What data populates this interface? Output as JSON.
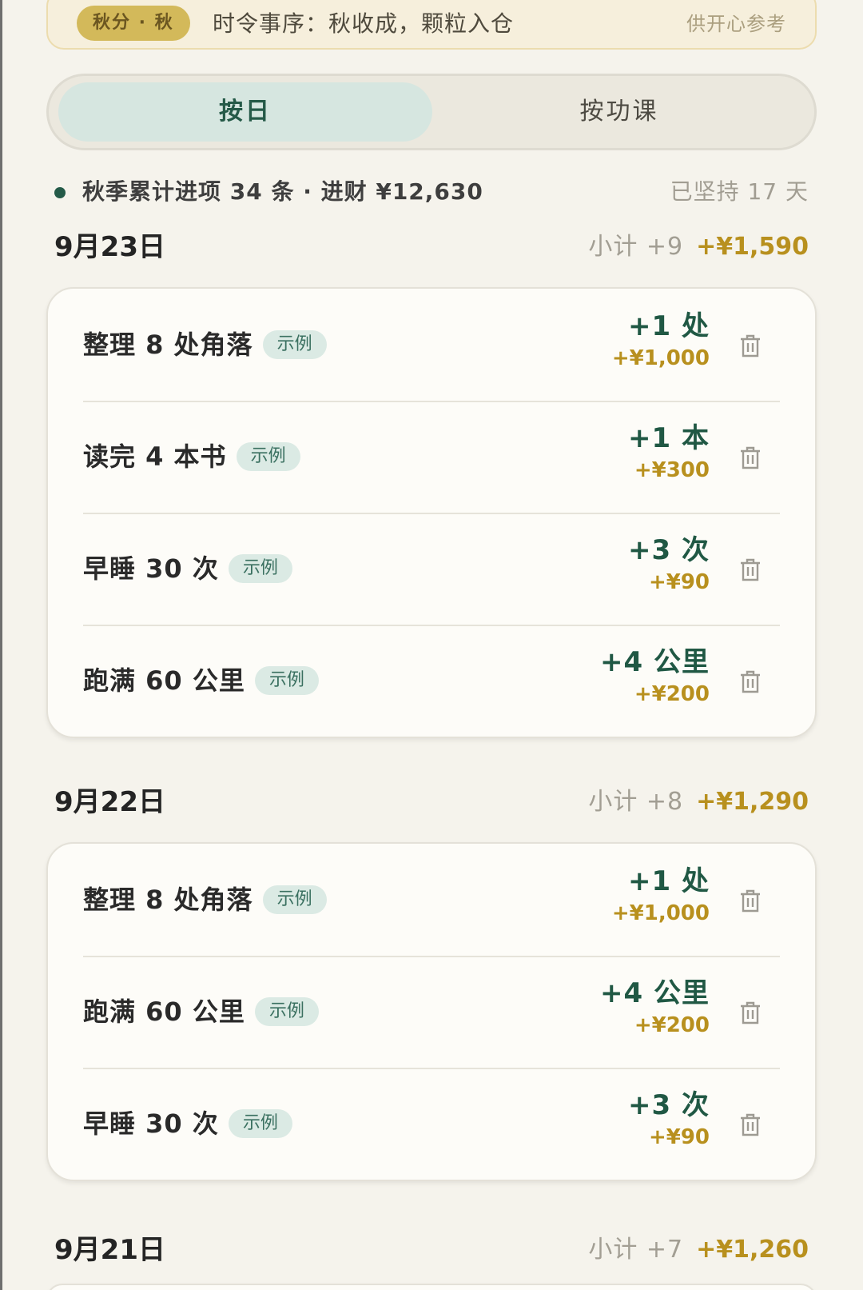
{
  "banner": {
    "badge": "秋分 · 秋",
    "text": "时令事序：秋收成，颗粒入仓",
    "note": "供开心参考"
  },
  "tabs": [
    {
      "label": "按日",
      "active": true
    },
    {
      "label": "按功课",
      "active": false
    }
  ],
  "summary": {
    "text": "秋季累计进项 34 条 · 进财 ¥12,630",
    "streak": "已坚持 17 天"
  },
  "colors": {
    "accent_green": "#245a48",
    "gold": "#b8901e",
    "tag_bg": "#dbeae4",
    "page_bg": "#f5f3ec"
  },
  "icons": {
    "delete": "trash-icon",
    "bullet": "dot-icon"
  },
  "days": [
    {
      "date": "9月23日",
      "count": "小计 +9",
      "money": "+¥1,590",
      "items": [
        {
          "title": "整理 8 处角落",
          "tag": "示例",
          "gain": "+1 处",
          "money": "+¥1,000"
        },
        {
          "title": "读完 4 本书",
          "tag": "示例",
          "gain": "+1 本",
          "money": "+¥300"
        },
        {
          "title": "早睡 30 次",
          "tag": "示例",
          "gain": "+3 次",
          "money": "+¥90"
        },
        {
          "title": "跑满 60 公里",
          "tag": "示例",
          "gain": "+4 公里",
          "money": "+¥200"
        }
      ]
    },
    {
      "date": "9月22日",
      "count": "小计 +8",
      "money": "+¥1,290",
      "items": [
        {
          "title": "整理 8 处角落",
          "tag": "示例",
          "gain": "+1 处",
          "money": "+¥1,000"
        },
        {
          "title": "跑满 60 公里",
          "tag": "示例",
          "gain": "+4 公里",
          "money": "+¥200"
        },
        {
          "title": "早睡 30 次",
          "tag": "示例",
          "gain": "+3 次",
          "money": "+¥90"
        }
      ]
    },
    {
      "date": "9月21日",
      "count": "小计 +7",
      "money": "+¥1,260",
      "items": []
    }
  ]
}
